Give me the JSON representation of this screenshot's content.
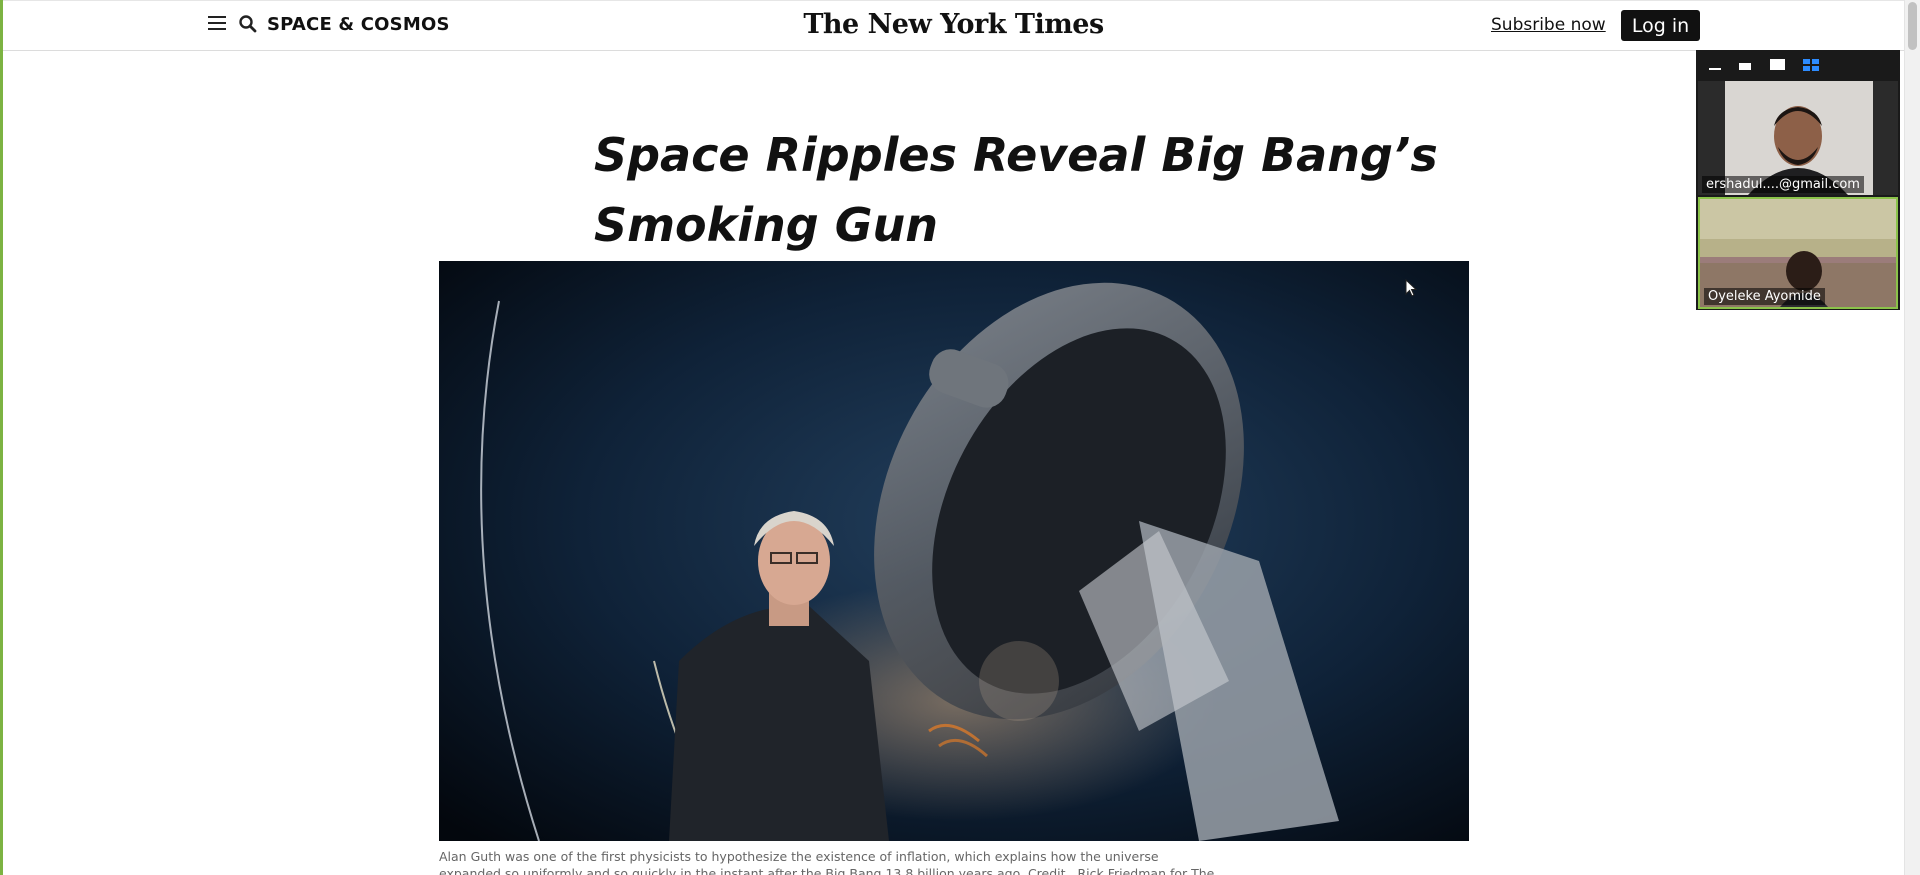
{
  "header": {
    "section_label": "SPACE & COSMOS",
    "masthead": "The New York Times",
    "subscribe_label": "Subsribe now",
    "login_label": "Log in"
  },
  "article": {
    "headline": "Space Ripples Reveal Big Bang’s Smoking Gun",
    "caption": "Alan Guth was one of the first physicists to hypothesize the existence of inflation, which explains how the universe expanded so uniformly and so quickly in the instant after the Big Bang 13.8 billion years ago. Credit...Rick Friedman for The New York Times"
  },
  "video_call": {
    "participants": [
      {
        "name": "ershadul....@gmail.com"
      },
      {
        "name": "Oyeleke Ayomide"
      }
    ],
    "active_color": "#8bc34a",
    "grid_color": "#2d8cff"
  },
  "icons": [
    "menu-icon",
    "search-icon",
    "minimize-icon",
    "small-view-icon",
    "medium-view-icon",
    "gallery-view-icon",
    "mouse-cursor-icon"
  ]
}
